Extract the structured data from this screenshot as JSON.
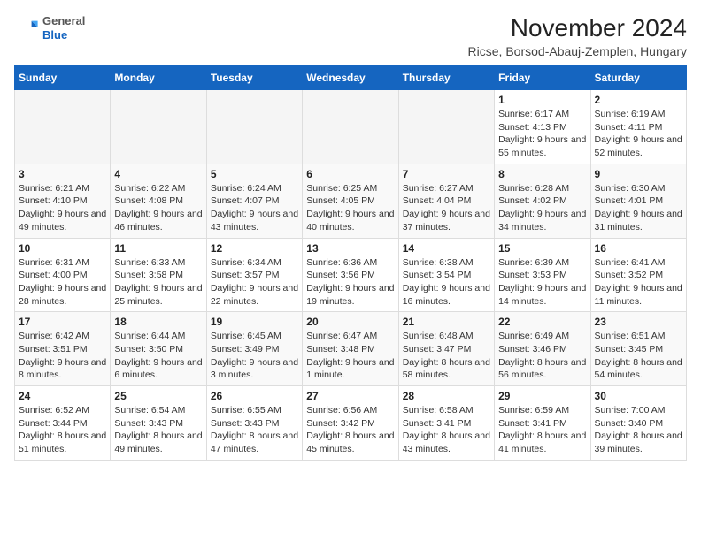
{
  "logo": {
    "general": "General",
    "blue": "Blue"
  },
  "title": "November 2024",
  "subtitle": "Ricse, Borsod-Abauj-Zemplen, Hungary",
  "days_of_week": [
    "Sunday",
    "Monday",
    "Tuesday",
    "Wednesday",
    "Thursday",
    "Friday",
    "Saturday"
  ],
  "weeks": [
    [
      {
        "day": "",
        "info": ""
      },
      {
        "day": "",
        "info": ""
      },
      {
        "day": "",
        "info": ""
      },
      {
        "day": "",
        "info": ""
      },
      {
        "day": "",
        "info": ""
      },
      {
        "day": "1",
        "info": "Sunrise: 6:17 AM\nSunset: 4:13 PM\nDaylight: 9 hours and 55 minutes."
      },
      {
        "day": "2",
        "info": "Sunrise: 6:19 AM\nSunset: 4:11 PM\nDaylight: 9 hours and 52 minutes."
      }
    ],
    [
      {
        "day": "3",
        "info": "Sunrise: 6:21 AM\nSunset: 4:10 PM\nDaylight: 9 hours and 49 minutes."
      },
      {
        "day": "4",
        "info": "Sunrise: 6:22 AM\nSunset: 4:08 PM\nDaylight: 9 hours and 46 minutes."
      },
      {
        "day": "5",
        "info": "Sunrise: 6:24 AM\nSunset: 4:07 PM\nDaylight: 9 hours and 43 minutes."
      },
      {
        "day": "6",
        "info": "Sunrise: 6:25 AM\nSunset: 4:05 PM\nDaylight: 9 hours and 40 minutes."
      },
      {
        "day": "7",
        "info": "Sunrise: 6:27 AM\nSunset: 4:04 PM\nDaylight: 9 hours and 37 minutes."
      },
      {
        "day": "8",
        "info": "Sunrise: 6:28 AM\nSunset: 4:02 PM\nDaylight: 9 hours and 34 minutes."
      },
      {
        "day": "9",
        "info": "Sunrise: 6:30 AM\nSunset: 4:01 PM\nDaylight: 9 hours and 31 minutes."
      }
    ],
    [
      {
        "day": "10",
        "info": "Sunrise: 6:31 AM\nSunset: 4:00 PM\nDaylight: 9 hours and 28 minutes."
      },
      {
        "day": "11",
        "info": "Sunrise: 6:33 AM\nSunset: 3:58 PM\nDaylight: 9 hours and 25 minutes."
      },
      {
        "day": "12",
        "info": "Sunrise: 6:34 AM\nSunset: 3:57 PM\nDaylight: 9 hours and 22 minutes."
      },
      {
        "day": "13",
        "info": "Sunrise: 6:36 AM\nSunset: 3:56 PM\nDaylight: 9 hours and 19 minutes."
      },
      {
        "day": "14",
        "info": "Sunrise: 6:38 AM\nSunset: 3:54 PM\nDaylight: 9 hours and 16 minutes."
      },
      {
        "day": "15",
        "info": "Sunrise: 6:39 AM\nSunset: 3:53 PM\nDaylight: 9 hours and 14 minutes."
      },
      {
        "day": "16",
        "info": "Sunrise: 6:41 AM\nSunset: 3:52 PM\nDaylight: 9 hours and 11 minutes."
      }
    ],
    [
      {
        "day": "17",
        "info": "Sunrise: 6:42 AM\nSunset: 3:51 PM\nDaylight: 9 hours and 8 minutes."
      },
      {
        "day": "18",
        "info": "Sunrise: 6:44 AM\nSunset: 3:50 PM\nDaylight: 9 hours and 6 minutes."
      },
      {
        "day": "19",
        "info": "Sunrise: 6:45 AM\nSunset: 3:49 PM\nDaylight: 9 hours and 3 minutes."
      },
      {
        "day": "20",
        "info": "Sunrise: 6:47 AM\nSunset: 3:48 PM\nDaylight: 9 hours and 1 minute."
      },
      {
        "day": "21",
        "info": "Sunrise: 6:48 AM\nSunset: 3:47 PM\nDaylight: 8 hours and 58 minutes."
      },
      {
        "day": "22",
        "info": "Sunrise: 6:49 AM\nSunset: 3:46 PM\nDaylight: 8 hours and 56 minutes."
      },
      {
        "day": "23",
        "info": "Sunrise: 6:51 AM\nSunset: 3:45 PM\nDaylight: 8 hours and 54 minutes."
      }
    ],
    [
      {
        "day": "24",
        "info": "Sunrise: 6:52 AM\nSunset: 3:44 PM\nDaylight: 8 hours and 51 minutes."
      },
      {
        "day": "25",
        "info": "Sunrise: 6:54 AM\nSunset: 3:43 PM\nDaylight: 8 hours and 49 minutes."
      },
      {
        "day": "26",
        "info": "Sunrise: 6:55 AM\nSunset: 3:43 PM\nDaylight: 8 hours and 47 minutes."
      },
      {
        "day": "27",
        "info": "Sunrise: 6:56 AM\nSunset: 3:42 PM\nDaylight: 8 hours and 45 minutes."
      },
      {
        "day": "28",
        "info": "Sunrise: 6:58 AM\nSunset: 3:41 PM\nDaylight: 8 hours and 43 minutes."
      },
      {
        "day": "29",
        "info": "Sunrise: 6:59 AM\nSunset: 3:41 PM\nDaylight: 8 hours and 41 minutes."
      },
      {
        "day": "30",
        "info": "Sunrise: 7:00 AM\nSunset: 3:40 PM\nDaylight: 8 hours and 39 minutes."
      }
    ]
  ]
}
